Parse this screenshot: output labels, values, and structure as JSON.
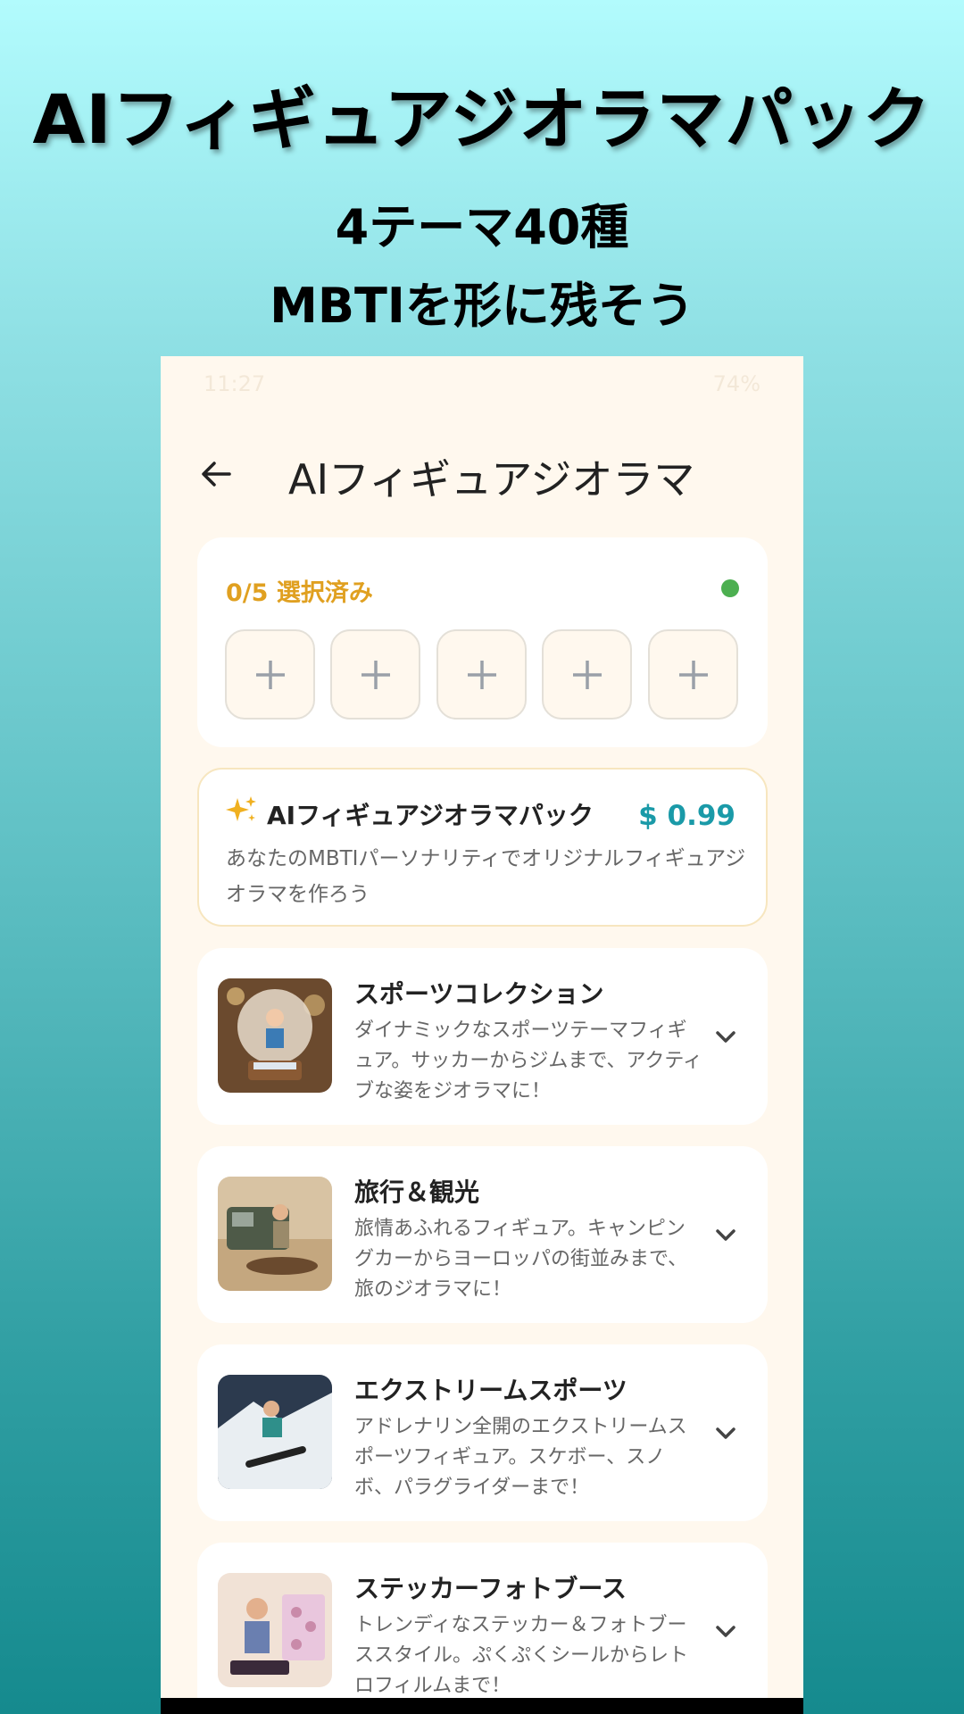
{
  "promo": {
    "title": "AIフィギュアジオラマパック",
    "subtitle_line1": "4テーマ40種",
    "subtitle_line2": "MBTIを形に残そう"
  },
  "status_bar": {
    "time": "11:27",
    "battery": "74%"
  },
  "app_bar": {
    "title": "AIフィギュアジオラマ"
  },
  "selection": {
    "label": "0/5 選択済み",
    "slots": [
      "+",
      "+",
      "+",
      "+",
      "+"
    ],
    "status_color": "#4caf50"
  },
  "pack": {
    "name": "AIフィギュアジオラマパック",
    "price": "$ 0.99",
    "description": "あなたのMBTIパーソナリティでオリジナルフィギュアジオラマを作ろう",
    "accent_color": "#1a9aa8"
  },
  "themes": [
    {
      "name": "スポーツコレクション",
      "description": "ダイナミックなスポーツテーマフィギュア。サッカーからジムまで、アクティブな姿をジオラマに！",
      "icon": "chevron-down-icon"
    },
    {
      "name": "旅行＆観光",
      "description": "旅情あふれるフィギュア。キャンピングカーからヨーロッパの街並みまで、旅のジオラマに！",
      "icon": "chevron-down-icon"
    },
    {
      "name": "エクストリームスポーツ",
      "description": "アドレナリン全開のエクストリームスポーツフィギュア。スケボー、スノボ、パラグライダーまで！",
      "icon": "chevron-down-icon"
    },
    {
      "name": "ステッカーフォトブース",
      "description": "トレンディなステッカー＆フォトブーススタイル。ぷくぷくシールからレトロフィルムまで！",
      "icon": "chevron-down-icon"
    }
  ]
}
